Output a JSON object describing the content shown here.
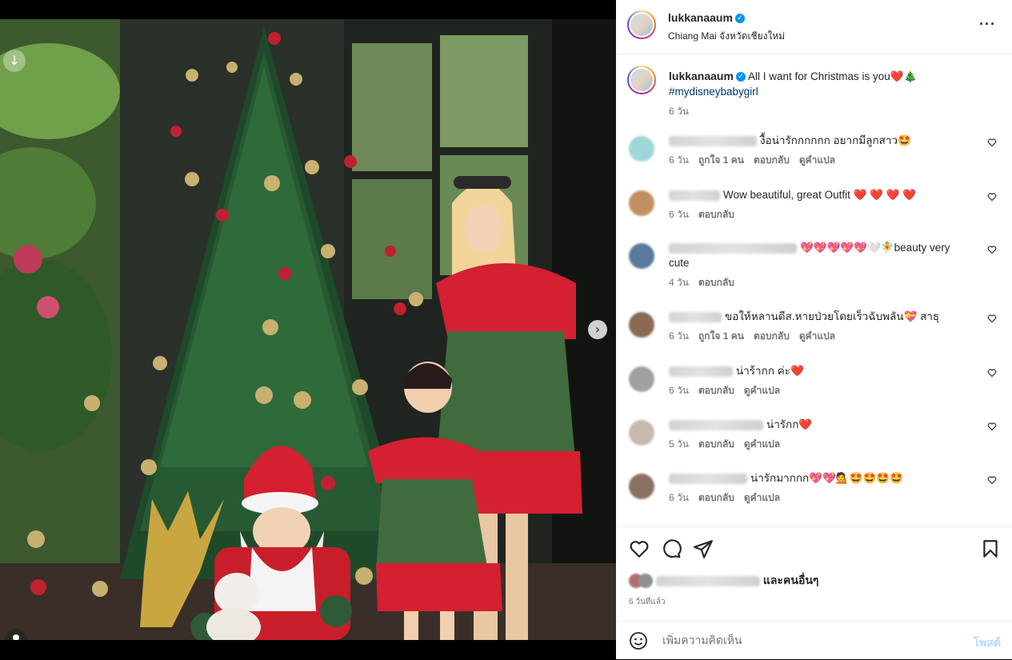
{
  "header": {
    "username": "lukkanaaum",
    "location": "Chiang Mai จังหวัดเชียงใหม่",
    "more": "···"
  },
  "caption": {
    "username": "lukkanaaum",
    "text": "All I want for Christmas is you❤️🎄",
    "hashtag": "#mydisneybabygirl",
    "time": "6 วัน"
  },
  "comments": [
    {
      "text": "งื้อน่ารักกกกกก อยากมีลูกสาว🤩",
      "time": "6 วัน",
      "likes": "ถูกใจ 1 คน",
      "reply": "ตอบกลับ",
      "translate": "ดูคำแปล",
      "avatar_color": "#9fd6d6"
    },
    {
      "text": "Wow beautiful, great Outfit ❤️ ❤️ ❤️ ❤️",
      "time": "6 วัน",
      "likes": "",
      "reply": "ตอบกลับ",
      "translate": "",
      "avatar_color": "#c09060"
    },
    {
      "text": "💖💖💖💖💖🤍🧚beauty very cute",
      "time": "4 วัน",
      "likes": "",
      "reply": "ตอบกลับ",
      "translate": "",
      "avatar_color": "#5a7a9a"
    },
    {
      "text": "ขอให้หลานดีส.หายป่วยโดยเร็วฉับพลัน💝 สาธุ",
      "time": "6 วัน",
      "likes": "ถูกใจ 1 คน",
      "reply": "ตอบกลับ",
      "translate": "ดูคำแปล",
      "avatar_color": "#8a6a50"
    },
    {
      "text": "น่าร้ากก ค่ะ❤️",
      "time": "6 วัน",
      "likes": "",
      "reply": "ตอบกลับ",
      "translate": "ดูคำแปล",
      "avatar_color": "#a0a0a0"
    },
    {
      "text": "น่ารักก❤️",
      "time": "5 วัน",
      "likes": "",
      "reply": "ตอบกลับ",
      "translate": "ดูคำแปล",
      "avatar_color": "#c8b8b0"
    },
    {
      "text": "น่ารักมากกก💖💖💁🤩🤩🤩🤩",
      "time": "6 วัน",
      "likes": "",
      "reply": "ตอบกลับ",
      "translate": "ดูคำแปล",
      "avatar_color": "#8a7060"
    }
  ],
  "actions": {
    "likes_suffix": "และคนอื่นๆ",
    "posted": "6 วันที่แล้ว"
  },
  "add_comment": {
    "placeholder": "เพิ่มความคิดเห็น",
    "post": "โพสต์"
  },
  "media": {
    "next": "›",
    "slide_count": 4,
    "active_slide": 1
  },
  "icons": [
    "heart-icon",
    "comment-icon",
    "share-icon",
    "bookmark-icon",
    "emoji-icon",
    "verified-icon",
    "more-icon",
    "download-icon",
    "tag-user-icon",
    "chevron-right-icon"
  ]
}
